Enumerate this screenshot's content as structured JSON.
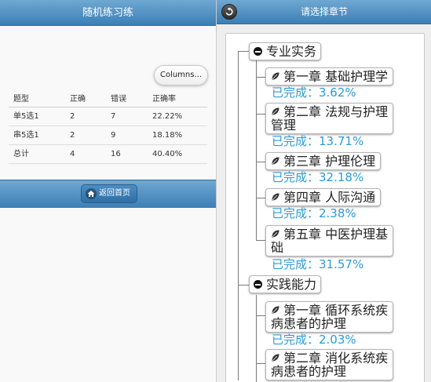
{
  "left_panel": {
    "title": "随机练习练",
    "columns_button": "Columns...",
    "table": {
      "headers": [
        "题型",
        "正确",
        "错误",
        "正确率"
      ],
      "rows": [
        [
          "单5选1",
          "2",
          "7",
          "22.22%"
        ],
        [
          "串5选1",
          "2",
          "9",
          "18.18%"
        ],
        [
          "总计",
          "4",
          "16",
          "40.40%"
        ]
      ]
    },
    "home_button": "返回首页",
    "icons": {
      "home": "home-icon"
    }
  },
  "right_panel": {
    "title": "请选择章节",
    "icons": {
      "back": "back-arrow-icon",
      "collapse": "minus-circle-icon",
      "chapter": "leaf-icon"
    },
    "accent_color": "#2e9ad6",
    "categories": [
      {
        "label": "专业实务",
        "chapters": [
          {
            "line1": "第一章 基础护理学",
            "line2": "",
            "progress": "已完成：3.62%"
          },
          {
            "line1": "第二章 法规与护理",
            "line2": "管理",
            "progress": "已完成：13.71%"
          },
          {
            "line1": "第三章 护理伦理",
            "line2": "",
            "progress": "已完成：32.18%"
          },
          {
            "line1": "第四章 人际沟通",
            "line2": "",
            "progress": "已完成：2.38%"
          },
          {
            "line1": "第五章 中医护理基",
            "line2": "础",
            "progress": "已完成：31.57%"
          }
        ]
      },
      {
        "label": "实践能力",
        "chapters": [
          {
            "line1": "第一章 循环系统疾",
            "line2": "病患者的护理",
            "progress": "已完成：2.03%"
          },
          {
            "line1": "第二章 消化系统疾",
            "line2": "病患者的护理",
            "progress": ""
          }
        ]
      }
    ]
  }
}
